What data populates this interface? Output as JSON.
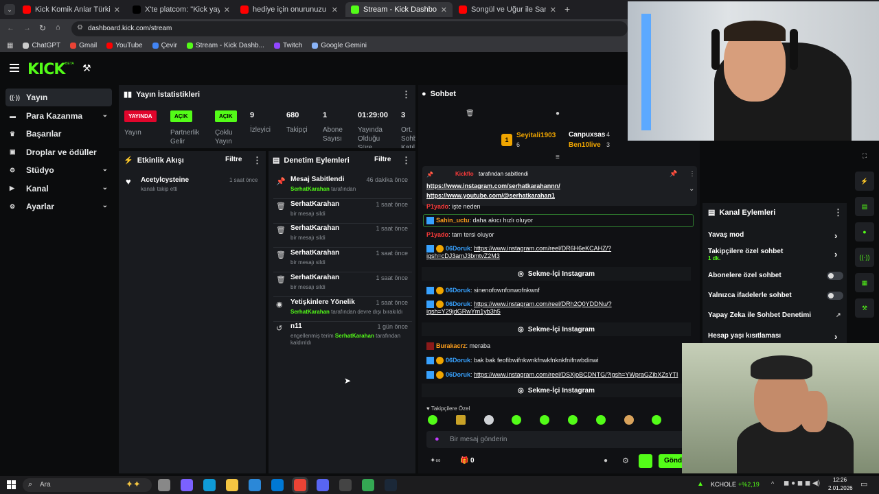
{
  "browser": {
    "tabs": [
      {
        "title": "Kick Komik Anlar Türkiye Rewin",
        "color": "#ff0000",
        "active": false
      },
      {
        "title": "X'te platcom: \"Kick yayıncısı Ca",
        "color": "#000000",
        "active": false
      },
      {
        "title": "hediye için onurunuzu şerefini",
        "color": "#ff0000",
        "active": false
      },
      {
        "title": "Stream - Kick Dashboard",
        "color": "#53fc18",
        "active": true
      },
      {
        "title": "Songül ve Uğur ile Sana Değer",
        "color": "#ff0000",
        "active": false
      }
    ],
    "url": "dashboard.kick.com/stream",
    "bookmarks": [
      "ChatGPT",
      "Gmail",
      "YouTube",
      "Çevir",
      "Stream - Kick Dashb...",
      "Twitch",
      "Google Gemini"
    ]
  },
  "header": {
    "logo": "KICK",
    "logo_sup": "BETA"
  },
  "sidebar": {
    "items": [
      {
        "label": "Yayın",
        "icon": "broadcast-icon",
        "chev": false
      },
      {
        "label": "Para Kazanma",
        "icon": "wallet-icon",
        "chev": true
      },
      {
        "label": "Başarılar",
        "icon": "trophy-icon",
        "chev": false
      },
      {
        "label": "Droplar ve ödüller",
        "icon": "gift-icon",
        "chev": false
      },
      {
        "label": "Stüdyo",
        "icon": "gear-icon",
        "chev": true
      },
      {
        "label": "Kanal",
        "icon": "channel-icon",
        "chev": true
      },
      {
        "label": "Ayarlar",
        "icon": "settings-icon",
        "chev": true
      }
    ]
  },
  "stats": {
    "title": "Yayın İstatistikleri",
    "live_badge": "YAYINDA",
    "live_label": "Yayın",
    "partner_badge": "AÇIK",
    "partner_label": "Partnerlik Gelir",
    "multi_badge": "AÇIK",
    "multi_label": "Çoklu Yayın",
    "viewers": "9",
    "viewers_label": "İzleyici",
    "followers": "680",
    "followers_label": "Takipçi",
    "subs": "1",
    "subs_label": "Abone Sayısı",
    "duration": "01:29:00",
    "duration_label": "Yayında Olduğu Süre",
    "avg": "3",
    "avg_label": "Ort. Sohb. Katıl."
  },
  "activity": {
    "title": "Etkinlik Akışı",
    "filter": "Filtre",
    "items": [
      {
        "user": "Acetylcysteine",
        "text": "kanalı takip etti",
        "time": "1 saat önce"
      }
    ]
  },
  "moderation": {
    "title": "Denetim Eylemleri",
    "filter": "Filtre",
    "items": [
      {
        "title": "Mesaj Sabitlendi",
        "icon": "pin-icon",
        "time": "46 dakika önce",
        "user": "SerhatKarahan",
        "text": " tarafından"
      },
      {
        "title": "SerhatKarahan",
        "icon": "trash-icon",
        "time": "1 saat önce",
        "user": "",
        "text": "bir mesajı sildi"
      },
      {
        "title": "SerhatKarahan",
        "icon": "trash-icon",
        "time": "1 saat önce",
        "user": "",
        "text": "bir mesajı sildi"
      },
      {
        "title": "SerhatKarahan",
        "icon": "trash-icon",
        "time": "1 saat önce",
        "user": "",
        "text": "bir mesajı sildi"
      },
      {
        "title": "SerhatKarahan",
        "icon": "trash-icon",
        "time": "1 saat önce",
        "user": "",
        "text": "bir mesajı sildi"
      },
      {
        "title": "Yetişkinlere Yönelik",
        "icon": "eye-icon",
        "time": "1 saat önce",
        "user": "SerhatKarahan",
        "text": " tarafından devre dışı bırakıldı"
      },
      {
        "title": "n11",
        "icon": "undo-icon",
        "time": "1 gün önce",
        "pre": "engellenmiş terim ",
        "user": "SerhatKarahan",
        "text": " tarafından kaldırıldı"
      }
    ]
  },
  "chat": {
    "title": "Sohbet",
    "top": [
      {
        "name": "Seyitali1903",
        "count": "6"
      },
      {
        "name": "Canpuxsas",
        "count": "4"
      },
      {
        "name": "Ben10live",
        "count": "3"
      }
    ],
    "pinned_by": "Kickflo",
    "pinned_suffix": " tarafından sabitlendi",
    "pinned_link1": "https://www.instagram.com/serhatkarahannn/",
    "pinned_link2": "https://www.youtube.com/@serhatkarahan1",
    "messages": [
      {
        "user": "P1yado",
        "color": "u-red",
        "text": ": işte neden"
      },
      {
        "user": "Sahin_uctu",
        "color": "u-orange",
        "text": ": daha akıcı hızlı oluyor"
      },
      {
        "user": "P1yado",
        "color": "u-red",
        "text": ": tam tersi oluyor"
      },
      {
        "user": "06Doruk",
        "color": "u-blue",
        "link": "https://www.instagram.com/reel/DR6H6eKCAHZ/?",
        "link2": "igsh=cDJ3amJ3bmtvZ2M3"
      },
      {
        "user": "06Doruk",
        "color": "u-blue",
        "text": ": sinenofownfonwofnkwnf"
      },
      {
        "user": "06Doruk",
        "color": "u-blue",
        "link": "https://www.instagram.com/reel/DRh2Q0YDDNu/?",
        "link2": "igsh=Y29jdGRwYm1yb3h5"
      },
      {
        "user": "Burakacrz",
        "color": "u-orange",
        "text": ": meraba"
      },
      {
        "user": "06Doruk",
        "color": "u-blue",
        "text": ": bak bak feofibwifnkwnkfnwkfnknkfnifnwbdinwi"
      },
      {
        "user": "06Doruk",
        "color": "u-blue",
        "link": "https://www.instagram.com/reel/DSXjoBCDNTG/?igsh=YWpraGZibXZsYTI"
      }
    ],
    "embed_label": "Sekme-İçi Instagram",
    "followers_only": "Takipçilere Özel",
    "input_placeholder": "Bir mesaj gönderin",
    "send": "Gönder",
    "bottom_count": "0"
  },
  "channel_actions": {
    "title": "Kanal Eylemleri",
    "rows": [
      {
        "label": "Yavaş mod",
        "kind": "chev"
      },
      {
        "label": "Takipçilere özel sohbet",
        "sub": "1 dk.",
        "kind": "chev"
      },
      {
        "label": "Abonelere özel sohbet",
        "kind": "toggle"
      },
      {
        "label": "Yalnızca ifadelerle sohbet",
        "kind": "toggle"
      },
      {
        "label": "Yapay Zeka ile Sohbet Denetimi",
        "kind": "ext"
      },
      {
        "label": "Hesap yaşı kısıtlaması",
        "kind": "chev"
      }
    ]
  },
  "taskbar": {
    "search": "Ara",
    "ticker": "KCHOLE",
    "ticker_change": "+%2,19",
    "time": "12:26",
    "date": "2.01.2026"
  }
}
